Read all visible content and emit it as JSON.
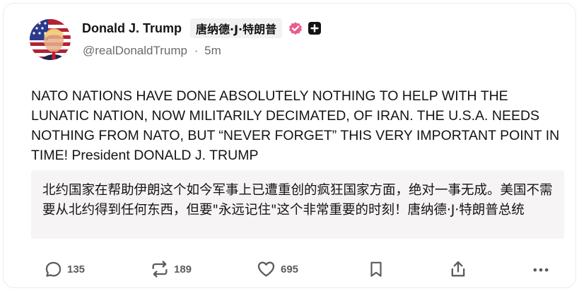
{
  "post": {
    "display_name": "Donald J. Trump",
    "name_tag": "唐纳德·J·特朗普",
    "handle": "@realDonaldTrump",
    "separator": "·",
    "time_ago": "5m",
    "text": "NATO NATIONS HAVE DONE ABSOLUTELY NOTHING TO HELP WITH THE LUNATIC NATION, NOW MILITARILY DECIMATED, OF IRAN. THE U.S.A. NEEDS NOTHING FROM NATO, BUT “NEVER FORGET” THIS VERY IMPORTANT POINT IN TIME! President DONALD J. TRUMP",
    "translation": "北约国家在帮助伊朗这个如今军事上已遭重创的疯狂国家方面，绝对一事无成。美国不需要从北约得到任何东西，但要\"永远记住\"这个非常重要的时刻！唐纳德·J·特朗普总统"
  },
  "actions": {
    "replies": "135",
    "reposts": "189",
    "likes": "695"
  },
  "icons": {
    "avatar": "flag-avatar",
    "verified": "verified-badge-icon",
    "badge": "plus-square-icon",
    "reply": "reply-icon",
    "repost": "repost-icon",
    "like": "heart-icon",
    "bookmark": "bookmark-icon",
    "share": "share-icon",
    "more": "more-icon"
  },
  "colors": {
    "verified": "#e85d8c",
    "text": "#141414",
    "muted": "#6b6b6b",
    "translation_bg": "#f6f4f4"
  }
}
